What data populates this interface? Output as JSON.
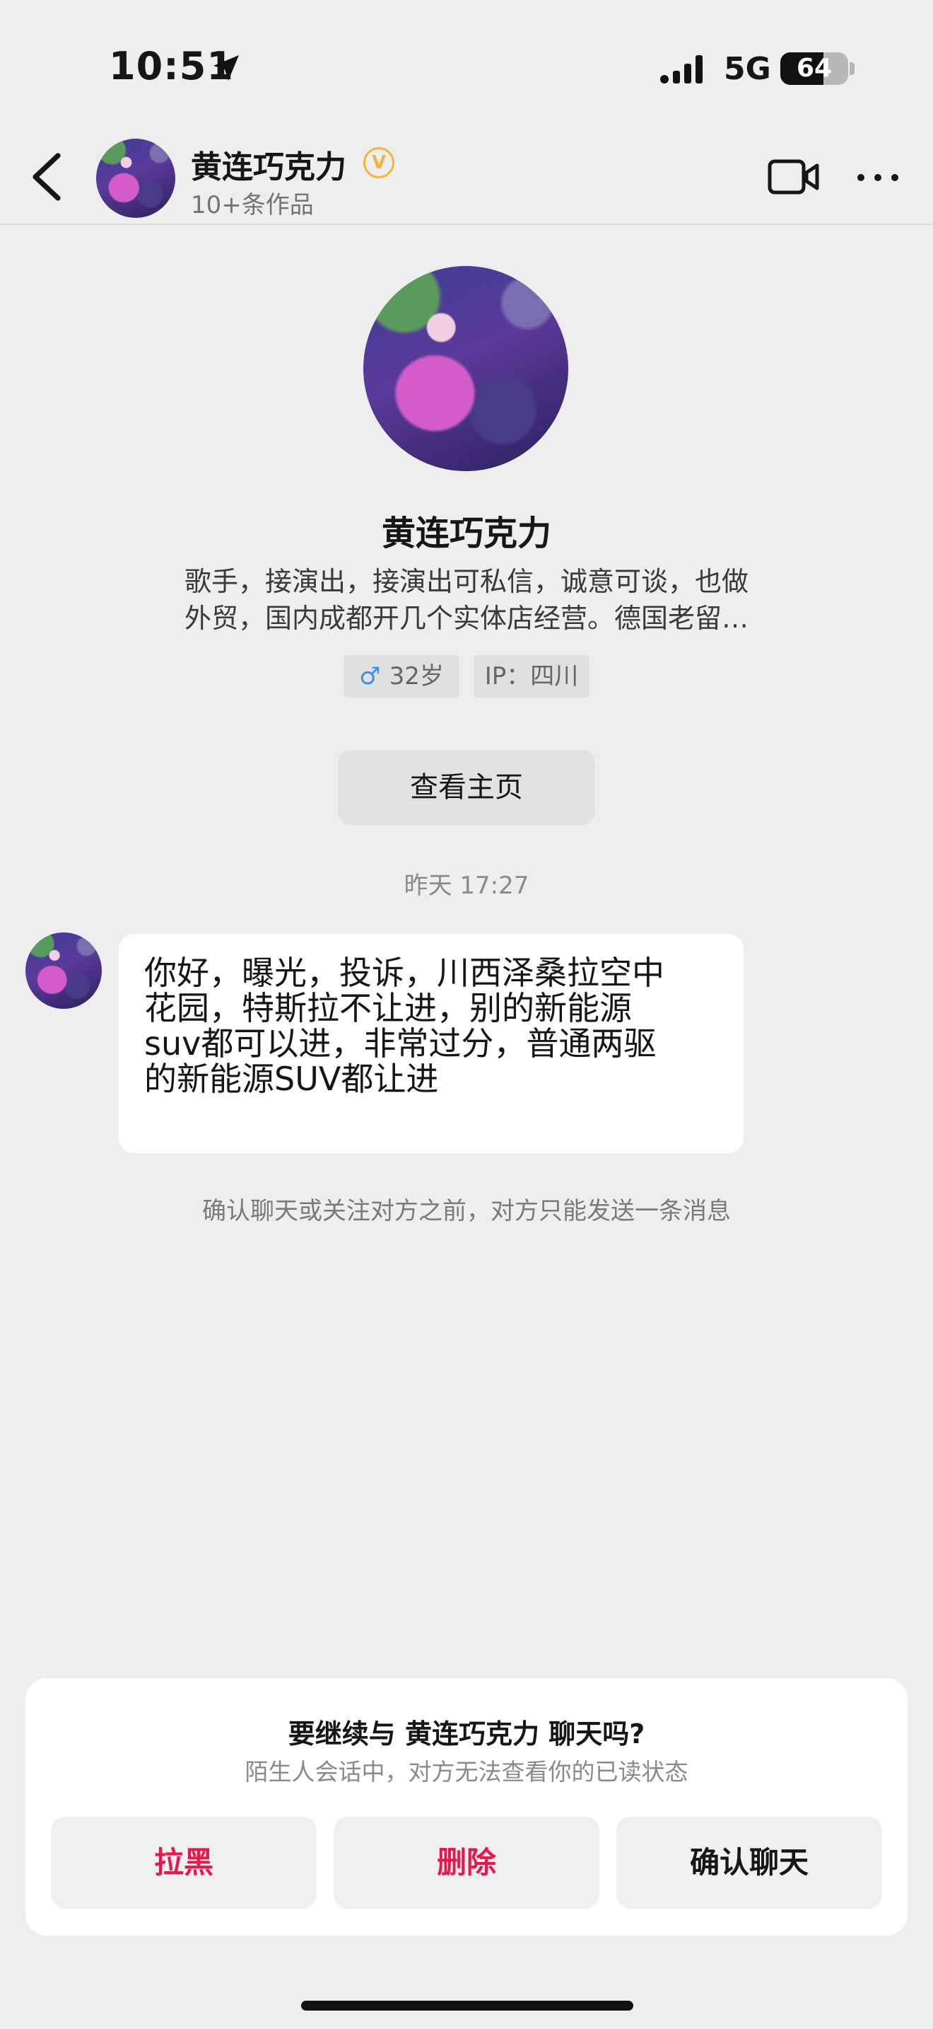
{
  "status_bar": {
    "time": "10:51",
    "network": "5G",
    "battery": "64",
    "battery_level_percent": 64
  },
  "nav": {
    "name": "黄连巧克力",
    "verified_mark": "V",
    "subtitle": "10+条作品",
    "icons": [
      "back-chevron-icon",
      "verified-icon",
      "video-call-icon",
      "more-icon"
    ]
  },
  "profile": {
    "name": "黄连巧克力",
    "bio_lines": [
      "歌手，接演出，接演出可私信，诚意可谈，也做",
      "外贸，国内成都开几个实体店经营。德国老留…"
    ],
    "gender_symbol": "♂",
    "age": "32岁",
    "ip": "IP：四川",
    "home_button": "查看主页"
  },
  "chat": {
    "timestamp": "昨天 17:27",
    "message_lines": [
      "你好，曝光，投诉，川西泽桑拉空中",
      "花园，特斯拉不让进，别的新能源",
      "suv都可以进，非常过分，普通两驱",
      "的新能源SUV都让进"
    ],
    "notice": "确认聊天或关注对方之前，对方只能发送一条消息"
  },
  "sheet": {
    "title": "要继续与 黄连巧克力 聊天吗?",
    "subtitle": "陌生人会话中，对方无法查看你的已读状态",
    "buttons": {
      "block": "拉黑",
      "delete": "删除",
      "confirm": "确认聊天"
    },
    "colors": {
      "danger": "#e8194a",
      "verified": "#f2b634",
      "male": "#3d8ee8"
    }
  }
}
